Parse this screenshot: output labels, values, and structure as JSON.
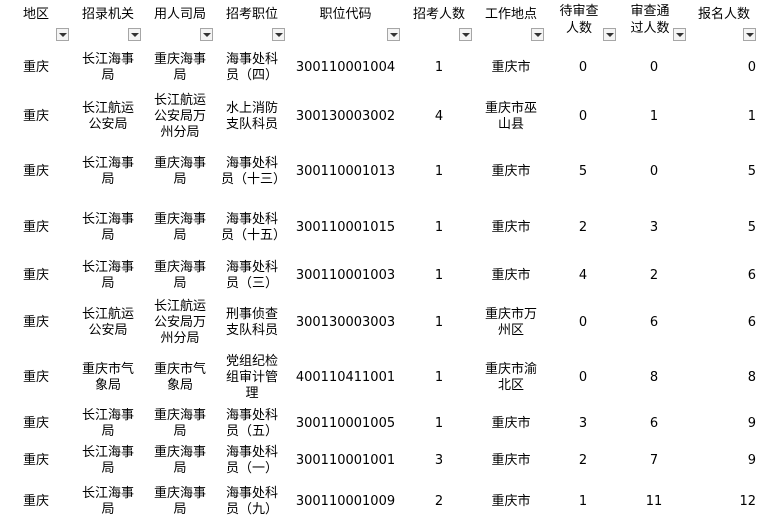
{
  "headers": [
    {
      "label": "地区"
    },
    {
      "label": "招录机关"
    },
    {
      "label": "用人司局"
    },
    {
      "label": "招考职位"
    },
    {
      "label": "职位代码"
    },
    {
      "label": "招考人数"
    },
    {
      "label": "工作地点"
    },
    {
      "label": "待审查人数"
    },
    {
      "label": "审查通过人数"
    },
    {
      "label": "报名人数"
    }
  ],
  "rows": [
    [
      "重庆",
      "长江海事局",
      "重庆海事局",
      "海事处科员（四）",
      "300110001004",
      "1",
      "重庆市",
      "0",
      "0",
      "0"
    ],
    [
      "重庆",
      "长江航运公安局",
      "长江航运公安局万州分局",
      "水上消防支队科员",
      "300130003002",
      "4",
      "重庆市巫山县",
      "0",
      "1",
      "1"
    ],
    [
      "重庆",
      "长江海事局",
      "重庆海事局",
      "海事处科员（十三）",
      "300110001013",
      "1",
      "重庆市",
      "5",
      "0",
      "5"
    ],
    [
      "重庆",
      "长江海事局",
      "重庆海事局",
      "海事处科员（十五）",
      "300110001015",
      "1",
      "重庆市",
      "2",
      "3",
      "5"
    ],
    [
      "重庆",
      "长江海事局",
      "重庆海事局",
      "海事处科员（三）",
      "300110001003",
      "1",
      "重庆市",
      "4",
      "2",
      "6"
    ],
    [
      "重庆",
      "长江航运公安局",
      "长江航运公安局万州分局",
      "刑事侦查支队科员",
      "300130003003",
      "1",
      "重庆市万州区",
      "0",
      "6",
      "6"
    ],
    [
      "重庆",
      "重庆市气象局",
      "重庆市气象局",
      "党组纪检组审计管理",
      "400110411001",
      "1",
      "重庆市渝北区",
      "0",
      "8",
      "8"
    ],
    [
      "重庆",
      "长江海事局",
      "重庆海事局",
      "海事处科员（五）",
      "300110001005",
      "1",
      "重庆市",
      "3",
      "6",
      "9"
    ],
    [
      "重庆",
      "长江海事局",
      "重庆海事局",
      "海事处科员（一）",
      "300110001001",
      "3",
      "重庆市",
      "2",
      "7",
      "9"
    ],
    [
      "重庆",
      "长江海事局",
      "重庆海事局",
      "海事处科员（九）",
      "300110001009",
      "2",
      "重庆市",
      "1",
      "11",
      "12"
    ]
  ]
}
